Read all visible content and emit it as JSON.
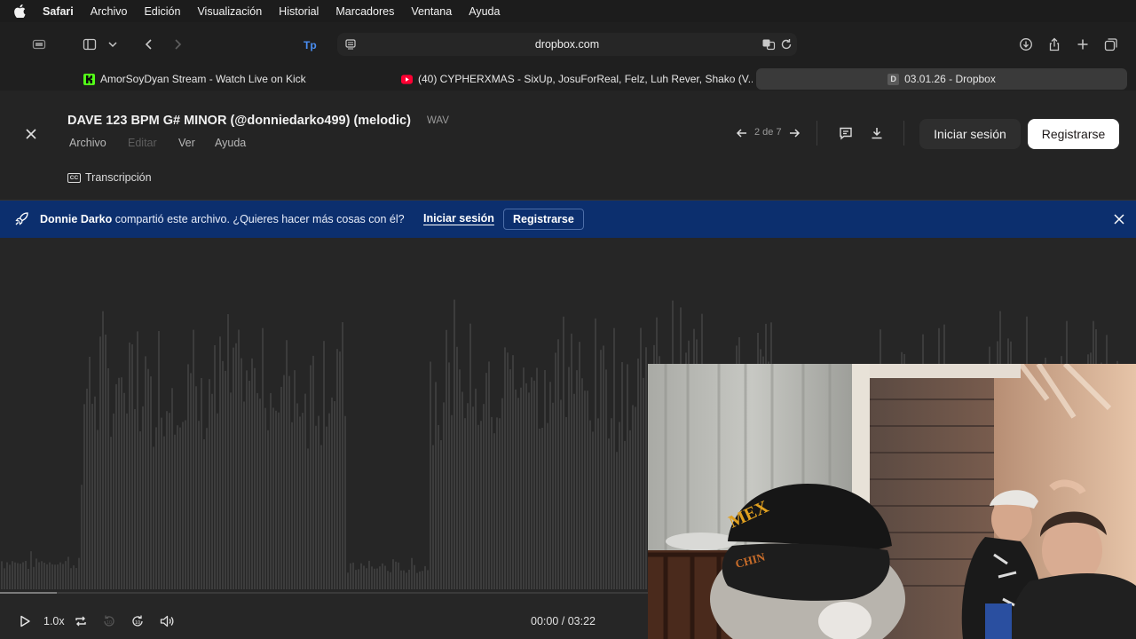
{
  "menubar": {
    "app": "Safari",
    "items": [
      "Archivo",
      "Edición",
      "Visualización",
      "Historial",
      "Marcadores",
      "Ventana",
      "Ayuda"
    ]
  },
  "toolbar": {
    "address": "dropbox.com",
    "extension_label": "Tp"
  },
  "tabs": [
    {
      "label": "AmorSoyDyan Stream - Watch Live on Kick",
      "favicon": "K",
      "favicon_color": "#53fc18",
      "active": false
    },
    {
      "label": "(40) CYPHERXMAS - SixUp, JosuForReal, Felz, Luh Rever, Shako (V...",
      "favicon": "youtube-icon",
      "favicon_color": "#ff0033",
      "active": false
    },
    {
      "label": "03.01.26 - Dropbox",
      "favicon": "D",
      "favicon_color": "#5a5a5a",
      "active": true
    }
  ],
  "file": {
    "title": "DAVE 123 BPM G# MINOR (@donniedarko499) (melodic)",
    "ext": "WAV",
    "menu": [
      "Archivo",
      "Editar",
      "Ver",
      "Ayuda"
    ],
    "transcript_label": "Transcripción",
    "transcript_icon_text": "CC",
    "counter": "2 de 7",
    "login_label": "Iniciar sesión",
    "register_label": "Registrarse"
  },
  "banner": {
    "user": "Donnie Darko",
    "message": " compartió este archivo. ¿Quieres hacer más cosas con él?",
    "login_label": "Iniciar sesión",
    "register_label": "Registrarse",
    "bg_color": "#0c2f6e"
  },
  "player": {
    "speed": "1.0x",
    "skip_back_label": "10",
    "skip_forward_label": "10",
    "time": "00:00 / 03:22",
    "progress": 0.05
  }
}
